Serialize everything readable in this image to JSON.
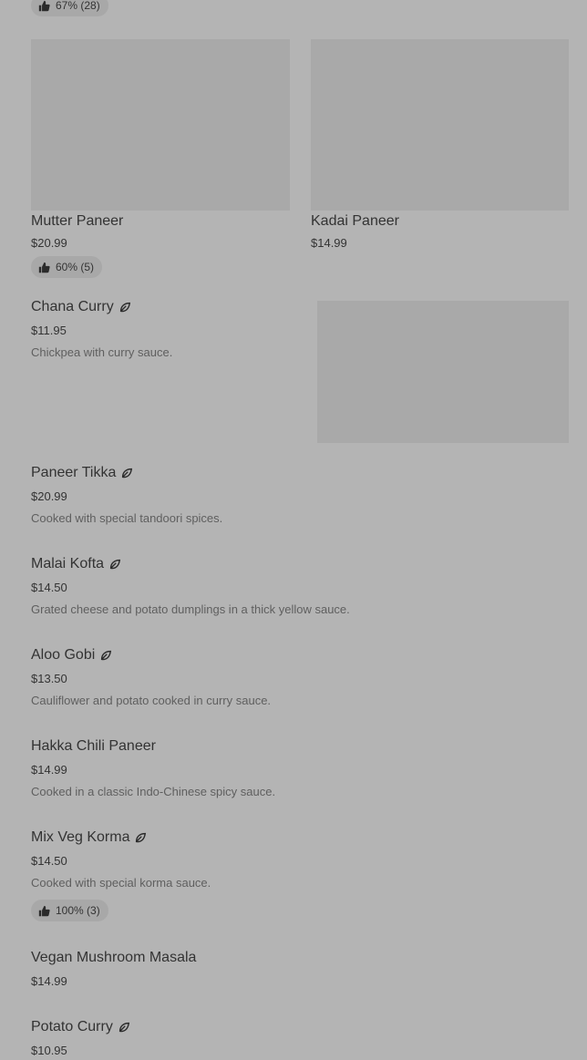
{
  "top_badge": {
    "rating": "67% (28)"
  },
  "cards": [
    {
      "name": "Mutter Paneer",
      "price": "$20.99",
      "rating": "60% (5)"
    },
    {
      "name": "Kadai Paneer",
      "price": "$14.99"
    }
  ],
  "items": [
    {
      "name": "Chana Curry",
      "vegetarian": true,
      "price": "$11.95",
      "description": "Chickpea with curry sauce."
    },
    {
      "name": "Paneer Tikka",
      "vegetarian": true,
      "price": "$20.99",
      "description": "Cooked with special tandoori spices."
    },
    {
      "name": "Malai Kofta",
      "vegetarian": true,
      "price": "$14.50",
      "description": "Grated cheese and potato dumplings in a thick yellow sauce."
    },
    {
      "name": "Aloo Gobi",
      "vegetarian": true,
      "price": "$13.50",
      "description": "Cauliflower and potato cooked in curry sauce."
    },
    {
      "name": "Hakka Chili Paneer",
      "vegetarian": false,
      "price": "$14.99",
      "description": "Cooked in a classic Indo-Chinese spicy sauce."
    },
    {
      "name": "Mix Veg Korma",
      "vegetarian": true,
      "price": "$14.50",
      "description": "Cooked with special korma sauce.",
      "rating": "100% (3)"
    },
    {
      "name": "Vegan Mushroom Masala",
      "vegetarian": false,
      "price": "$14.99"
    },
    {
      "name": "Potato Curry",
      "vegetarian": true,
      "price": "$10.95"
    }
  ],
  "icons": {
    "thumb": "thumbs-up-icon",
    "leaf": "leaf-icon"
  },
  "colors": {
    "overlay_background": "#b4b4b4",
    "placeholder": "#a9a9a9",
    "badge": "#a8a8a8"
  }
}
